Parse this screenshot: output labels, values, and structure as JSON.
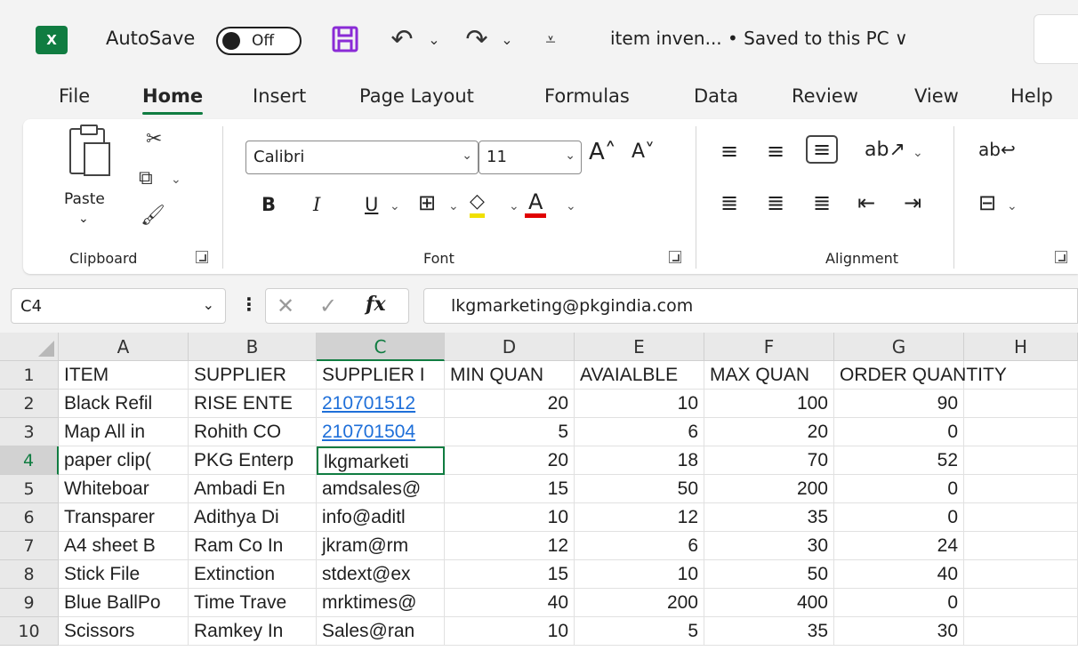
{
  "titlebar": {
    "app_logo": "X",
    "autosave_label": "AutoSave",
    "autosave_state": "Off",
    "document_title": "item inven...  •  Saved to this PC ∨"
  },
  "tabs": [
    "File",
    "Home",
    "Insert",
    "Page Layout",
    "Formulas",
    "Data",
    "Review",
    "View",
    "Help"
  ],
  "active_tab": "Home",
  "ribbon": {
    "clipboard": {
      "paste_label": "Paste",
      "group_label": "Clipboard"
    },
    "font": {
      "font_name": "Calibri",
      "font_size": "11",
      "group_label": "Font",
      "bold": "B",
      "italic": "I",
      "underline": "U"
    },
    "alignment": {
      "group_label": "Alignment"
    }
  },
  "formula_bar": {
    "name_box": "C4",
    "fx_label": "fx",
    "formula": "lkgmarketing@pkgindia.com"
  },
  "sheet": {
    "columns": [
      "A",
      "B",
      "C",
      "D",
      "E",
      "F",
      "G",
      "H"
    ],
    "active_cell": "C4",
    "rows": [
      {
        "num": "1",
        "cells": [
          "ITEM",
          "SUPPLIER",
          "SUPPLIER I",
          "MIN QUAN",
          "AVAIALBLE",
          "MAX QUAN",
          "ORDER QUANTITY",
          ""
        ]
      },
      {
        "num": "2",
        "cells": [
          "Black Refil",
          "RISE ENTE",
          "210701512",
          "20",
          "10",
          "100",
          "90",
          ""
        ]
      },
      {
        "num": "3",
        "cells": [
          "Map All in",
          "Rohith CO",
          "210701504",
          "5",
          "6",
          "20",
          "0",
          ""
        ]
      },
      {
        "num": "4",
        "cells": [
          "paper clip(",
          "PKG Enterp",
          "lkgmarketi",
          "20",
          "18",
          "70",
          "52",
          ""
        ]
      },
      {
        "num": "5",
        "cells": [
          "Whiteboar",
          "Ambadi En",
          "amdsales@",
          "15",
          "50",
          "200",
          "0",
          ""
        ]
      },
      {
        "num": "6",
        "cells": [
          "Transparer",
          "Adithya Di",
          "info@aditl",
          "10",
          "12",
          "35",
          "0",
          ""
        ]
      },
      {
        "num": "7",
        "cells": [
          "A4 sheet B",
          "Ram Co In",
          "jkram@rm",
          "12",
          "6",
          "30",
          "24",
          ""
        ]
      },
      {
        "num": "8",
        "cells": [
          "Stick File",
          "Extinction",
          "stdext@ex",
          "15",
          "10",
          "50",
          "40",
          ""
        ]
      },
      {
        "num": "9",
        "cells": [
          "Blue BallPo",
          "Time Trave",
          "mrktimes@",
          "40",
          "200",
          "400",
          "0",
          ""
        ]
      },
      {
        "num": "10",
        "cells": [
          "Scissors",
          "Ramkey In",
          "Sales@ran",
          "10",
          "5",
          "35",
          "30",
          ""
        ]
      }
    ]
  }
}
